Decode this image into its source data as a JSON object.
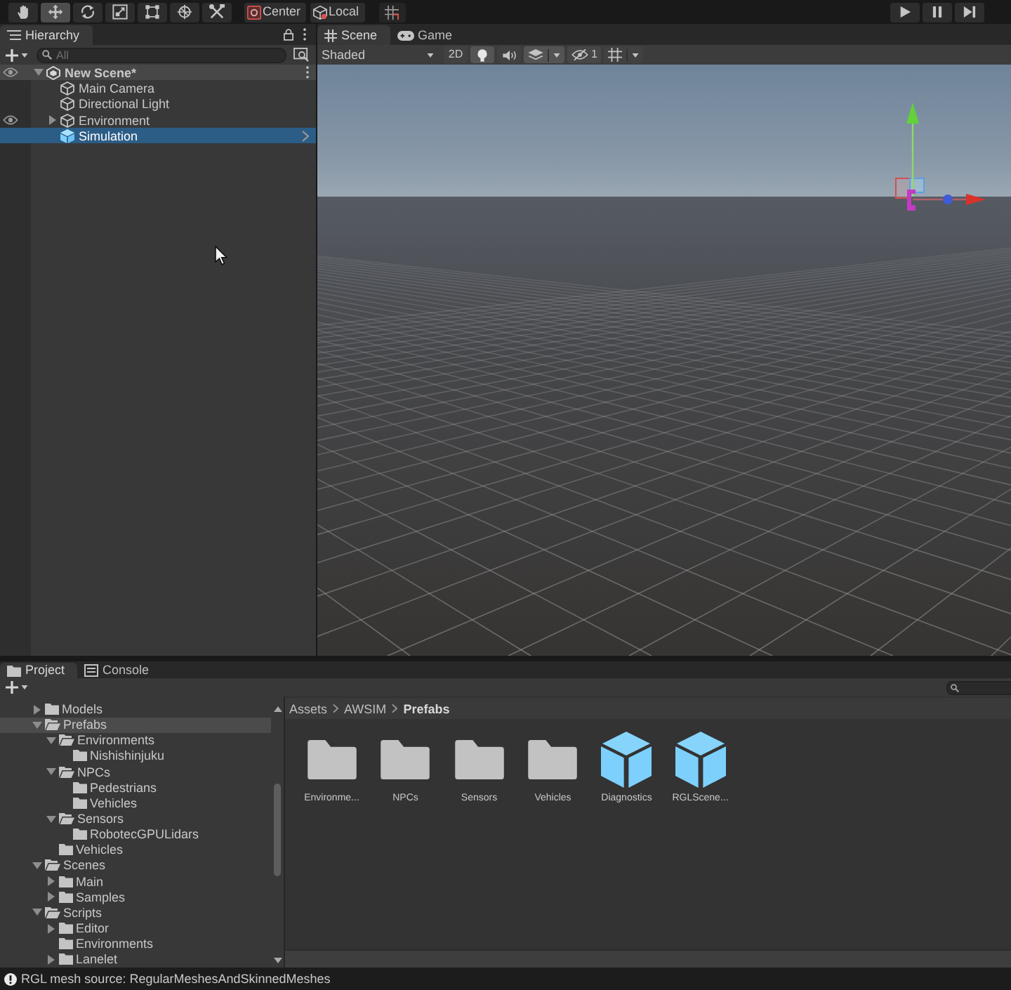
{
  "toolbar": {
    "tools": [
      {
        "kind": "hand",
        "selected": false
      },
      {
        "kind": "move",
        "selected": true
      },
      {
        "kind": "rotate",
        "selected": false
      },
      {
        "kind": "scale",
        "selected": false
      },
      {
        "kind": "rect",
        "selected": false
      },
      {
        "kind": "transform",
        "selected": false
      },
      {
        "kind": "custom",
        "selected": false
      }
    ],
    "handle_buttons": [
      {
        "kind": "pivot",
        "label": "Center"
      },
      {
        "kind": "space",
        "label": "Local"
      }
    ],
    "playback": [
      {
        "kind": "play"
      },
      {
        "kind": "pause"
      },
      {
        "kind": "step"
      }
    ]
  },
  "hierarchy": {
    "tabs": [
      {
        "label": "Hierarchy",
        "selected": true
      }
    ],
    "search": {
      "placeholder": "All"
    },
    "scene": {
      "name": "New Scene*",
      "expanded": true,
      "selected": false,
      "eye_icon": true,
      "children": [
        {
          "name": "Main Camera",
          "prefab": false,
          "selected": false,
          "eye_icon": false
        },
        {
          "name": "Directional Light",
          "prefab": false,
          "selected": false,
          "eye_icon": false
        },
        {
          "name": "Environment",
          "prefab": false,
          "expanded": false,
          "selected": false,
          "eye_icon": true
        },
        {
          "name": "Simulation",
          "prefab": true,
          "selected": true,
          "eye_icon": false
        }
      ]
    }
  },
  "scene_view": {
    "tabs": [
      {
        "label": "Scene",
        "kind": "scene",
        "selected": true
      },
      {
        "label": "Game",
        "kind": "game",
        "selected": false
      }
    ],
    "shading": "Shaded",
    "toggles": [
      {
        "kind": "dimension",
        "label": "2D",
        "on": false
      },
      {
        "kind": "lighting",
        "on": true
      },
      {
        "kind": "audio",
        "on": false
      },
      {
        "kind": "effects",
        "on": true
      },
      {
        "kind": "hidden",
        "label": "1"
      },
      {
        "kind": "gizmos",
        "on": false
      }
    ]
  },
  "project": {
    "tabs": [
      {
        "label": "Project",
        "kind": "project",
        "selected": true
      },
      {
        "label": "Console",
        "kind": "console",
        "selected": false
      }
    ],
    "tree": [
      {
        "name": "Models",
        "expanded": false,
        "selected": false
      },
      {
        "name": "Prefabs",
        "expanded": true,
        "selected": true,
        "children": [
          {
            "name": "Environments",
            "expanded": true,
            "selected": false,
            "children": [
              {
                "name": "Nishishinjuku",
                "selected": false
              }
            ]
          },
          {
            "name": "NPCs",
            "expanded": true,
            "selected": false,
            "children": [
              {
                "name": "Pedestrians",
                "selected": false
              },
              {
                "name": "Vehicles",
                "selected": false
              }
            ]
          },
          {
            "name": "Sensors",
            "expanded": true,
            "selected": false,
            "children": [
              {
                "name": "RobotecGPULidars",
                "selected": false
              }
            ]
          },
          {
            "name": "Vehicles",
            "selected": false
          }
        ]
      },
      {
        "name": "Scenes",
        "expanded": true,
        "selected": false,
        "children": [
          {
            "name": "Main",
            "expanded": false,
            "selected": false
          },
          {
            "name": "Samples",
            "expanded": false,
            "selected": false
          }
        ]
      },
      {
        "name": "Scripts",
        "expanded": true,
        "selected": false,
        "children": [
          {
            "name": "Editor",
            "expanded": false,
            "selected": false
          },
          {
            "name": "Environments",
            "selected": false
          },
          {
            "name": "Lanelet",
            "expanded": false,
            "selected": false
          }
        ]
      }
    ],
    "breadcrumb": [
      {
        "label": "Assets",
        "current": false
      },
      {
        "label": "AWSIM",
        "current": false
      },
      {
        "label": "Prefabs",
        "current": true
      }
    ],
    "assets": [
      {
        "name": "Environme...",
        "kind": "folder"
      },
      {
        "name": "NPCs",
        "kind": "folder"
      },
      {
        "name": "Sensors",
        "kind": "folder"
      },
      {
        "name": "Vehicles",
        "kind": "folder"
      },
      {
        "name": "Diagnostics",
        "kind": "prefab"
      },
      {
        "name": "RGLScene...",
        "kind": "prefab"
      }
    ]
  },
  "status_bar": {
    "message": "RGL mesh source: RegularMeshesAndSkinnedMeshes"
  }
}
